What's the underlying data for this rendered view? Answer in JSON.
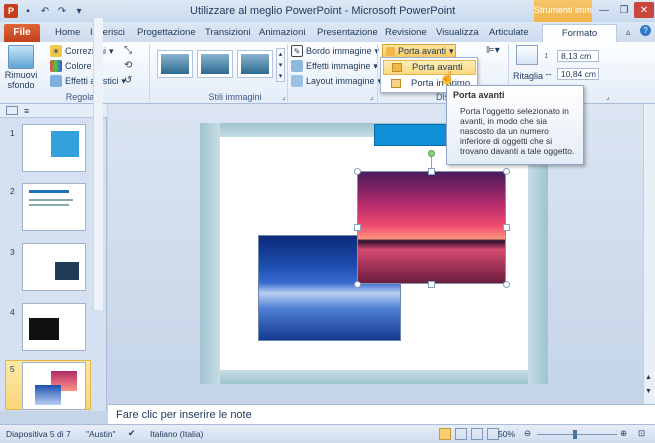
{
  "window": {
    "title": "Utilizzare al meglio PowerPoint - Microsoft PowerPoint",
    "context_group": "Strumenti imm",
    "app_icon": "P"
  },
  "tabs": {
    "file": "File",
    "items": [
      "Home",
      "Inserisci",
      "Progettazione",
      "Transizioni",
      "Animazioni",
      "Presentazione",
      "Revisione",
      "Visualizza",
      "Articulate"
    ],
    "active": "Formato"
  },
  "ribbon": {
    "remove_bg": [
      "Rimuovi",
      "sfondo"
    ],
    "corrections": "Correzioni",
    "color": "Colore",
    "artistic": "Effetti artistici",
    "group_regola": "Regola",
    "group_stili": "Stili immagini",
    "group_disp": "Disp",
    "border": "Bordo immagine",
    "effects": "Effetti immagine",
    "layout": "Layout immagine",
    "bring_forward": "Porta avanti",
    "crop": "Ritaglia",
    "height": "8,13 cm",
    "width": "10,84 cm"
  },
  "dropdown": {
    "item1": "Porta avanti",
    "item2": "Porta in primo"
  },
  "tooltip": {
    "title": "Porta avanti",
    "body": "Porta l'oggetto selezionato in avanti, in modo che sia nascosto da un numero inferiore di oggetti che si trovano davanti a tale oggetto."
  },
  "slides": [
    "1",
    "2",
    "3",
    "4",
    "5"
  ],
  "notes": "Fare clic per inserire le note",
  "status": {
    "slide": "Diapositiva 5 di 7",
    "theme": "\"Austin\"",
    "language": "Italiano (Italia)",
    "zoom": "50%"
  }
}
